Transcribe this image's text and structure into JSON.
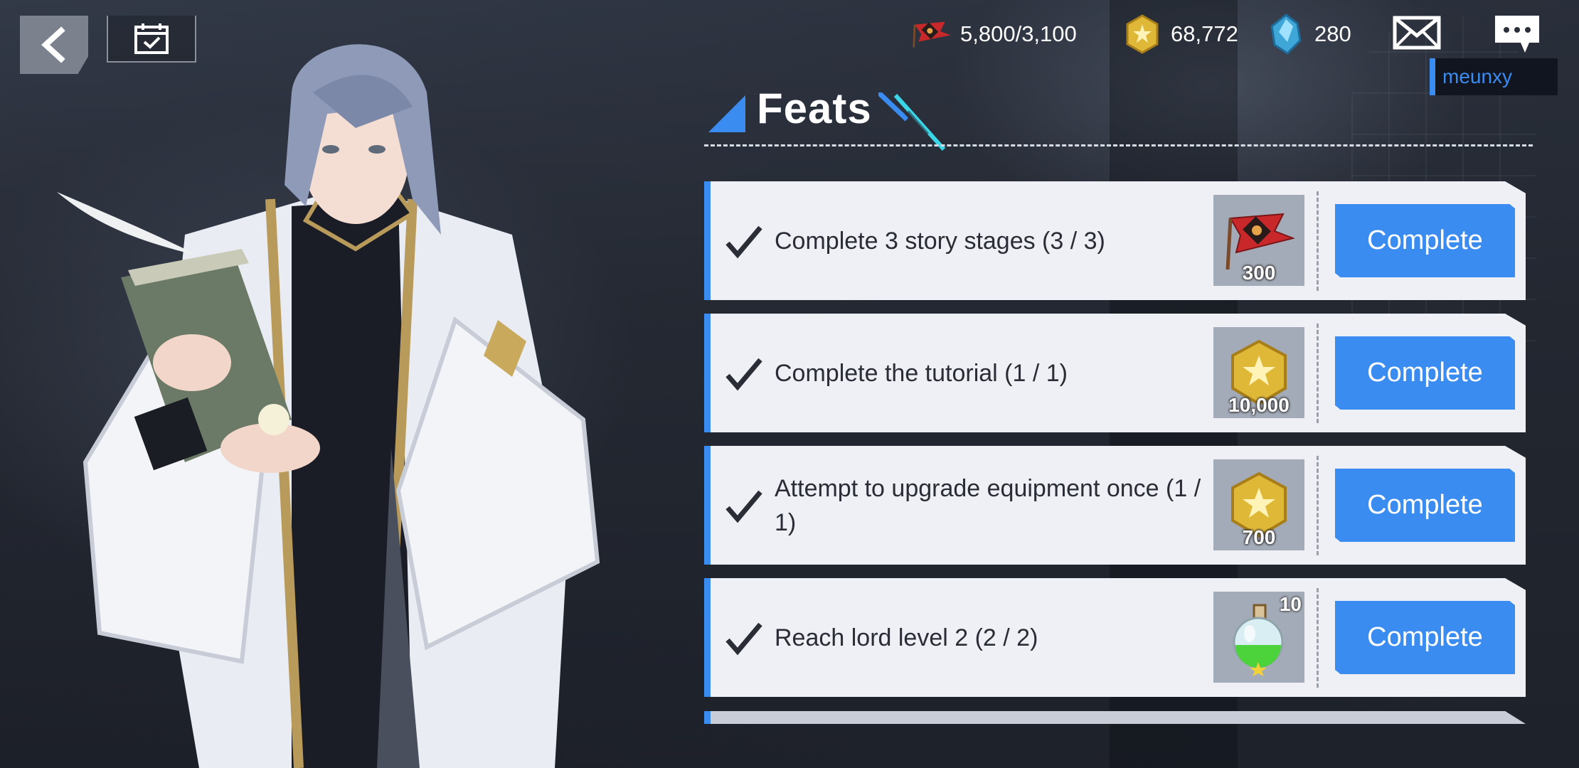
{
  "header": {
    "resources": [
      {
        "icon": "stamina-flag-icon",
        "value": "5,800/3,100"
      },
      {
        "icon": "gold-coin-icon",
        "value": "68,772"
      },
      {
        "icon": "crystal-icon",
        "value": "280"
      }
    ],
    "username": "meunxy"
  },
  "page": {
    "title": "Feats"
  },
  "feats": [
    {
      "label": "Complete 3 story stages (3 / 3)",
      "reward_icon": "stamina-flag-icon",
      "reward_qty": "300",
      "button": "Complete"
    },
    {
      "label": "Complete the tutorial (1 / 1)",
      "reward_icon": "gold-coin-icon",
      "reward_qty": "10,000",
      "button": "Complete"
    },
    {
      "label": "Attempt to upgrade equipment once (1 / 1)",
      "reward_icon": "gold-coin-icon",
      "reward_qty": "700",
      "button": "Complete"
    },
    {
      "label": "Reach lord level 2 (2 / 2)",
      "reward_icon": "green-potion-icon",
      "reward_qty": "10",
      "button": "Complete"
    }
  ],
  "colors": {
    "accent": "#3a8cf0",
    "row_bg": "#eef0f6",
    "text_dark": "#2a2d35"
  }
}
